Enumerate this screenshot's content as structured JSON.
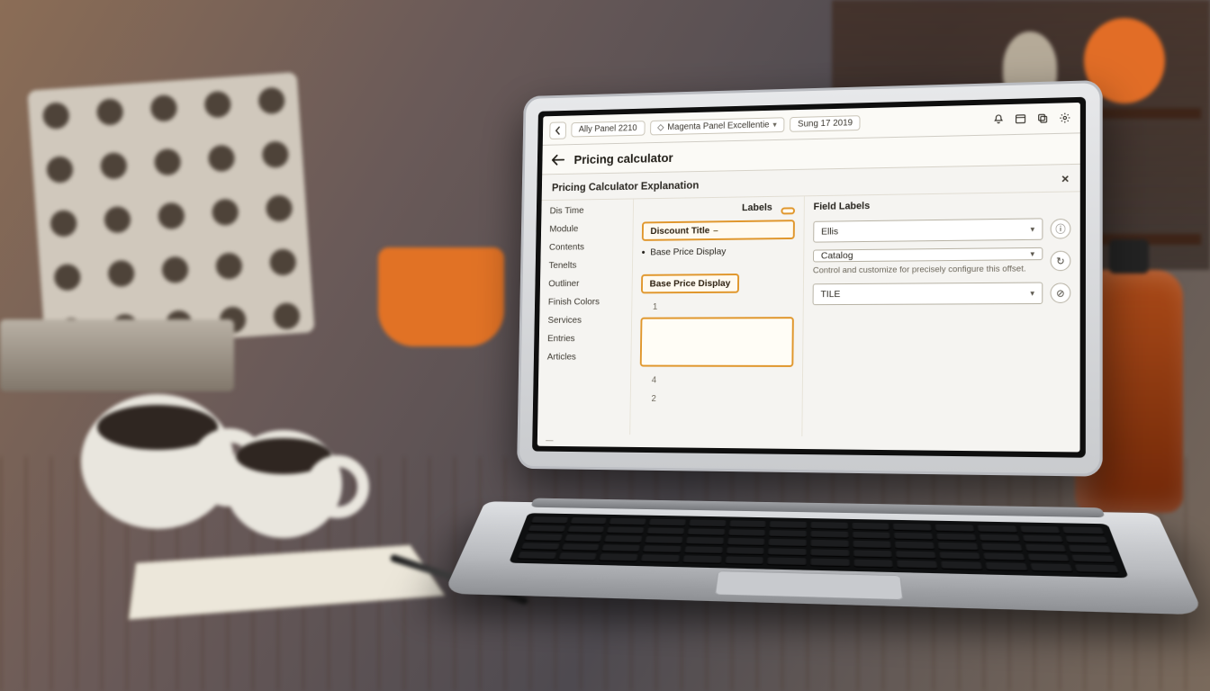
{
  "topbar": {
    "back_icon": "chevron-left",
    "crumb1": "Ally Panel 2210",
    "crumb2_prefix": "◇",
    "crumb2": "Magenta Panel Excellentie",
    "crumb3": "Sung 17 2019",
    "icons": [
      "bell",
      "panel",
      "copy",
      "gear"
    ]
  },
  "page": {
    "back_icon": "arrow-left",
    "title": "Pricing calculator",
    "section_title": "Pricing Calculator Explanation",
    "close_icon": "×"
  },
  "sidebar": {
    "items": [
      "Dis Time",
      "Module",
      "Contents",
      "Tenelts",
      "Outliner",
      "Finish Colors",
      "Services",
      "Entries",
      "Articles"
    ]
  },
  "mid": {
    "header": "Labels",
    "chip_top": "",
    "chip_discount": "Discount Title",
    "chip_discount_dash": "–",
    "bullet_base": "Base Price Display",
    "chip_base": "Base Price Display",
    "aux_rows": [
      {
        "k": "",
        "v": "1"
      },
      {
        "k": "",
        "v": "4"
      },
      {
        "k": "",
        "v": "2"
      }
    ]
  },
  "right": {
    "header": "Field Labels",
    "select1": "Ellis",
    "action1_icon": "ⓘ",
    "select2": "Catalog",
    "hint": "Control and customize for precisely configure this offset.",
    "action2_icon": "↻",
    "select3": "TILE",
    "action3_icon": "⊘"
  },
  "footer": "—"
}
